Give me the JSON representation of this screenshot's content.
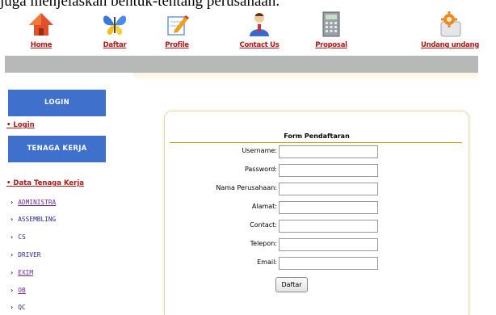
{
  "top_strip_text": "juga menjelaskan bentuk-tentang perusahaan.",
  "nav": {
    "items": [
      {
        "label": "Home",
        "icon": "home-icon"
      },
      {
        "label": "Daftar",
        "icon": "butterfly-icon"
      },
      {
        "label": "Profile",
        "icon": "edit-icon"
      },
      {
        "label": "Contact Us",
        "icon": "person-icon"
      },
      {
        "label": "Proposal",
        "icon": "calculator-icon"
      },
      {
        "label": "Undang undang",
        "icon": "settings-icon"
      }
    ]
  },
  "sidebar": {
    "login_button": "LOGIN",
    "login_link": "Login",
    "tenaga_kerja_button": "TENAGA KERJA",
    "data_link": "Data Tenaga Kerja",
    "categories": [
      {
        "label": "ADMINISTRA",
        "link": true
      },
      {
        "label": "ASSEMBLING",
        "link": false
      },
      {
        "label": "CS",
        "link": false
      },
      {
        "label": "DRIVER",
        "link": false
      },
      {
        "label": "EXIM",
        "link": true
      },
      {
        "label": "OB",
        "link": true
      },
      {
        "label": "QC",
        "link": false
      }
    ]
  },
  "form": {
    "title": "Form Pendaftaran",
    "fields": [
      {
        "label": "Username:",
        "value": ""
      },
      {
        "label": "Password:",
        "value": ""
      },
      {
        "label": "Nama Perusahaan:",
        "value": ""
      },
      {
        "label": "Alamat:",
        "value": ""
      },
      {
        "label": "Contact:",
        "value": ""
      },
      {
        "label": "Telepon:",
        "value": ""
      },
      {
        "label": "Email:",
        "value": ""
      }
    ],
    "submit": "Daftar"
  },
  "colors": {
    "nav_link": "#b01818",
    "sidebar_button": "#3f71cc",
    "grey_band": "#b7b8b8",
    "form_rule": "#c8a800"
  }
}
